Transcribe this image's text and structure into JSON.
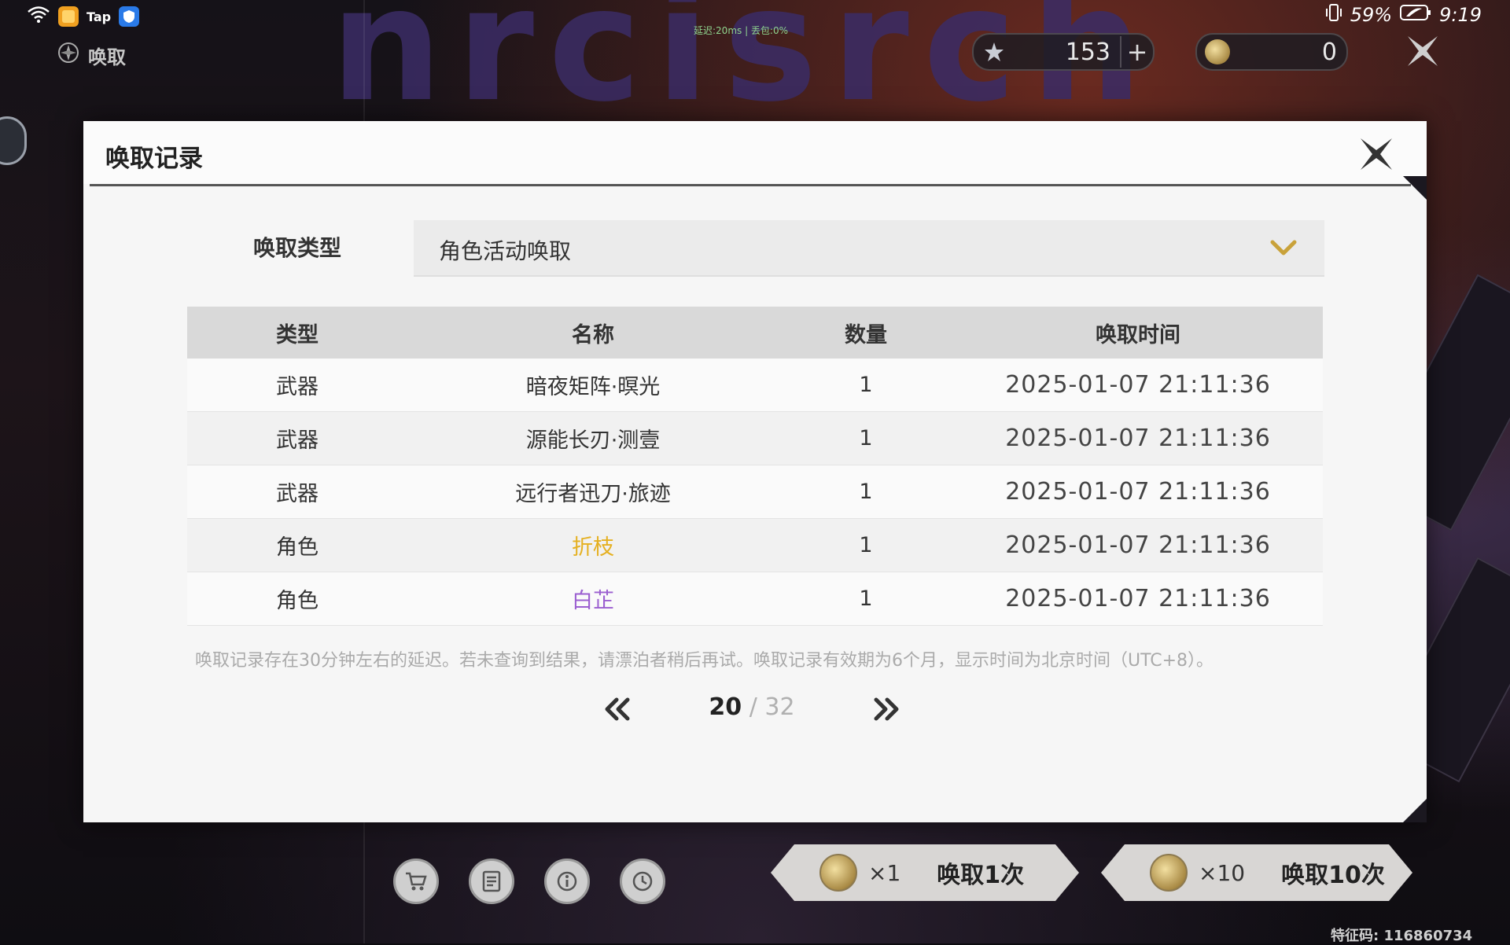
{
  "status_bar": {
    "app_icon_text": "Tap",
    "network_info": "延迟:20ms | 丢包:0%",
    "battery": "59%",
    "time": "9:19"
  },
  "hud": {
    "screen_title": "唤取",
    "currency_1_value": "153",
    "currency_2_value": "0"
  },
  "modal": {
    "title": "唤取记录",
    "filter_label": "唤取类型",
    "filter_value": "角色活动唤取",
    "columns": [
      "类型",
      "名称",
      "数量",
      "唤取时间"
    ],
    "rows": [
      {
        "type": "武器",
        "name": "暗夜矩阵·暝光",
        "qty": "1",
        "time": "2025-01-07 21:11:36",
        "rarity_color": "#333333"
      },
      {
        "type": "武器",
        "name": "源能长刃·测壹",
        "qty": "1",
        "time": "2025-01-07 21:11:36",
        "rarity_color": "#333333"
      },
      {
        "type": "武器",
        "name": "远行者迅刀·旅迹",
        "qty": "1",
        "time": "2025-01-07 21:11:36",
        "rarity_color": "#333333"
      },
      {
        "type": "角色",
        "name": "折枝",
        "qty": "1",
        "time": "2025-01-07 21:11:36",
        "rarity_color": "#e5b020"
      },
      {
        "type": "角色",
        "name": "白芷",
        "qty": "1",
        "time": "2025-01-07 21:11:36",
        "rarity_color": "#9b5fd0"
      }
    ],
    "note": "唤取记录存在30分钟左右的延迟。若未查询到结果，请漂泊者稍后再试。唤取记录有效期为6个月，显示时间为北京时间（UTC+8）。",
    "pager": {
      "current": "20",
      "separator": "/",
      "total": "32"
    }
  },
  "bottom": {
    "pull_1": {
      "mult": "×1",
      "label": "唤取1次"
    },
    "pull_10": {
      "mult": "×10",
      "label": "唤取10次"
    },
    "uid": "特征码: 116860734",
    "tool_icons": [
      "shop-icon",
      "list-icon",
      "info-icon",
      "history-icon"
    ]
  },
  "colors": {
    "accent_gold": "#c9a23a",
    "five_star": "#e5b020",
    "four_star": "#9b5fd0"
  }
}
